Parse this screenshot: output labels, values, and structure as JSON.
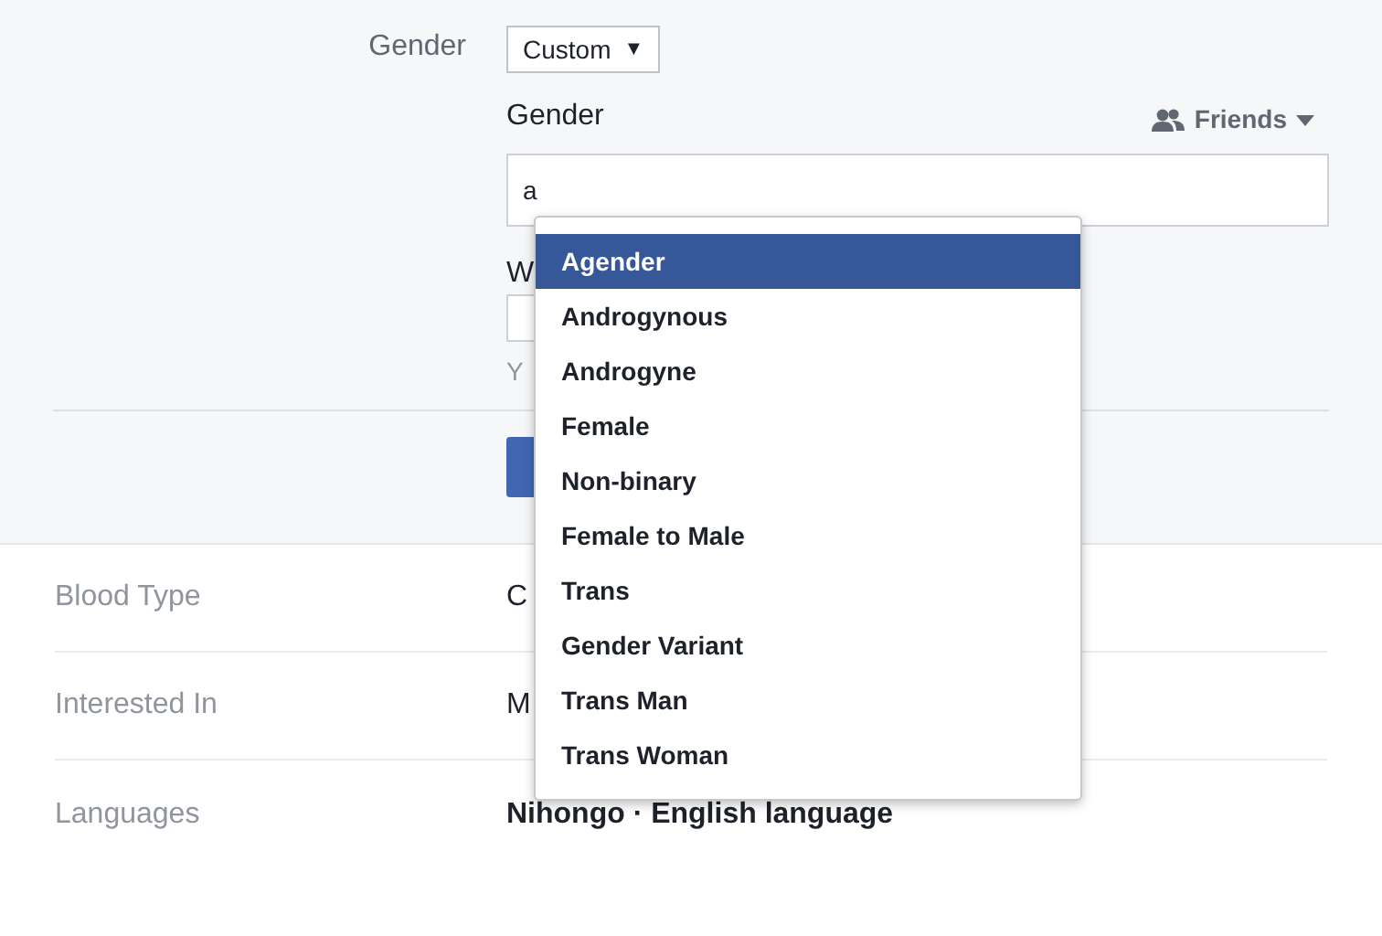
{
  "gender_row": {
    "label": "Gender",
    "select": "Custom",
    "select_caret": "▼"
  },
  "custom_gender": {
    "label": "Gender",
    "audience": "Friends",
    "input_value": "a",
    "second_label": "W",
    "help_text": "Y"
  },
  "suggestions": [
    {
      "label": "Agender",
      "selected": true
    },
    {
      "label": "Androgynous",
      "selected": false
    },
    {
      "label": "Androgyne",
      "selected": false
    },
    {
      "label": "Female",
      "selected": false
    },
    {
      "label": "Non-binary",
      "selected": false
    },
    {
      "label": "Female to Male",
      "selected": false
    },
    {
      "label": "Trans",
      "selected": false
    },
    {
      "label": "Gender Variant",
      "selected": false
    },
    {
      "label": "Trans Man",
      "selected": false
    },
    {
      "label": "Trans Woman",
      "selected": false
    }
  ],
  "rows": [
    {
      "label": "Blood Type",
      "value": "C"
    },
    {
      "label": "Interested In",
      "value": "M"
    },
    {
      "label": "Languages",
      "value": "Nihongo · English language",
      "bold": true
    }
  ]
}
